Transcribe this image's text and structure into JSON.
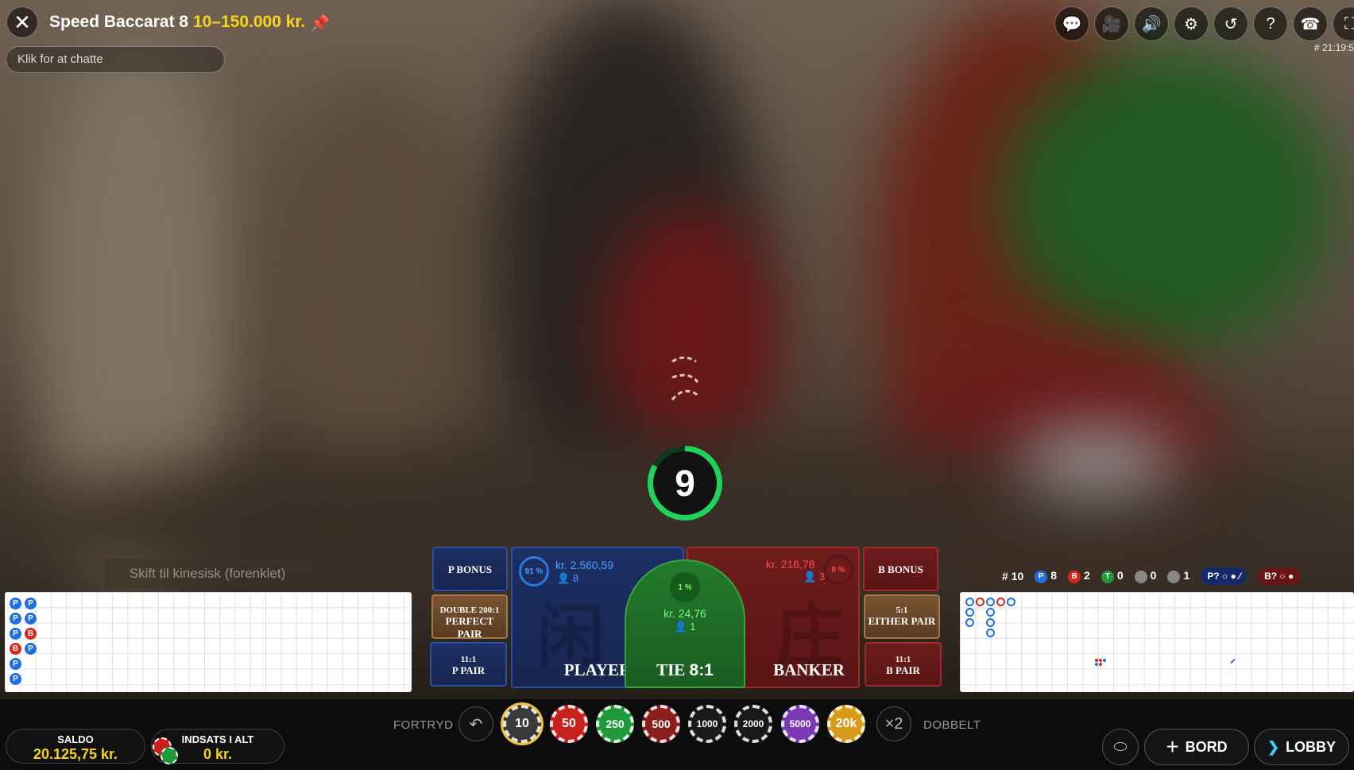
{
  "header": {
    "table_name": "Speed Baccarat 8",
    "limits": "10–150.000 kr.",
    "chat_placeholder": "Klik for at chatte",
    "round_id": "# 21:19:5"
  },
  "icons": [
    "chat-icon",
    "video-icon",
    "sound-icon",
    "settings-icon",
    "history-icon",
    "help-icon",
    "support-icon",
    "fullscreen-icon"
  ],
  "timer": {
    "value": "9",
    "fraction": 0.83
  },
  "language_button": "Skift til kinesisk (forenklet)",
  "bets": {
    "p_bonus": "P BONUS",
    "perfect_pair_odds": "DOUBLE 200:1",
    "perfect_pair": "PERFECT PAIR",
    "p_pair_odds": "11:1",
    "p_pair": "P PAIR",
    "player": "PLAYER",
    "player_percent": "91 %",
    "player_amount": "kr. 2.560,59",
    "player_count": "8",
    "tie": "TIE",
    "tie_odds": "8:1",
    "tie_percent": "1 %",
    "tie_amount": "kr. 24,76",
    "tie_count": "1",
    "banker": "BANKER",
    "banker_percent": "8 %",
    "banker_amount": "kr. 216,78",
    "banker_count": "3",
    "b_bonus": "B BONUS",
    "either_pair_odds": "5:1",
    "either_pair": "EITHER PAIR",
    "b_pair_odds": "11:1",
    "b_pair": "B PAIR"
  },
  "stats": {
    "rounds": "# 10",
    "player_wins": "8",
    "banker_wins": "2",
    "ties": "0",
    "player_pairs": "0",
    "banker_pairs": "1",
    "p_ask": "P?",
    "b_ask": "B?"
  },
  "bead_road": [
    [
      "P",
      "P",
      "P",
      "B",
      "P",
      "P"
    ],
    [
      "P",
      "P",
      "B",
      "P"
    ]
  ],
  "bottom": {
    "balance_label": "SALDO",
    "balance_value": "20.125,75 kr.",
    "total_bet_label": "INDSATS I ALT",
    "total_bet_value": "0 kr.",
    "undo": "FORTRYD",
    "double": "DOBBELT",
    "double_icon": "×2",
    "table_btn": "BORD",
    "lobby_btn": "LOBBY"
  },
  "chips": [
    {
      "label": "10",
      "color": "#3a3a3a"
    },
    {
      "label": "50",
      "color": "#c8201e"
    },
    {
      "label": "250",
      "color": "#1e9a3a"
    },
    {
      "label": "500",
      "color": "#8c1d1d"
    },
    {
      "label": "1000",
      "color": "#1a1a1a"
    },
    {
      "label": "2000",
      "color": "#1a1a1a"
    },
    {
      "label": "5000",
      "color": "#7a3ab5"
    },
    {
      "label": "20k",
      "color": "#d89a1a"
    }
  ]
}
